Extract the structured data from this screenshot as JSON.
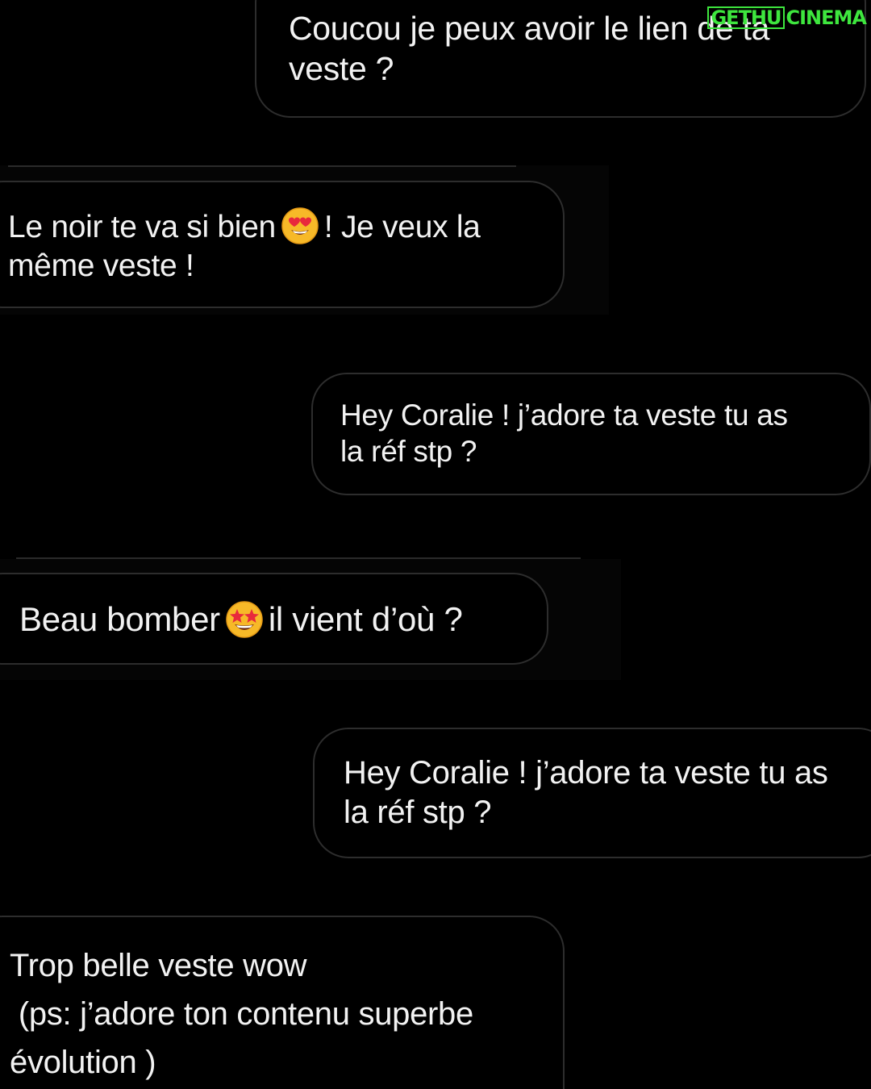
{
  "watermark": {
    "part1": "GETHU",
    "part2": "CINEMA",
    "color": "#3ee63e"
  },
  "messages": [
    {
      "side": "sent",
      "text": "Coucou je peux avoir le lien de ta\nveste ?"
    },
    {
      "side": "received",
      "text_before": "Le noir te va si bien",
      "emoji": "heart-eyes-emoji",
      "text_after": "! Je veux la\nmême veste !"
    },
    {
      "side": "sent",
      "text": "Hey Coralie ! j’adore ta veste tu as\nla réf stp ?"
    },
    {
      "side": "received",
      "text_before": "Beau bomber",
      "emoji": "star-struck-emoji",
      "text_after": "il vient d’où ?"
    },
    {
      "side": "sent",
      "text": "Hey Coralie ! j’adore ta veste tu as\nla réf stp ?"
    },
    {
      "side": "received",
      "text": "Trop belle veste wow\n (ps: j’adore ton contenu superbe\névolution )"
    }
  ],
  "colors": {
    "background": "#000000",
    "bubble_border": "#2d2d2d",
    "text": "#f2f2f2"
  }
}
